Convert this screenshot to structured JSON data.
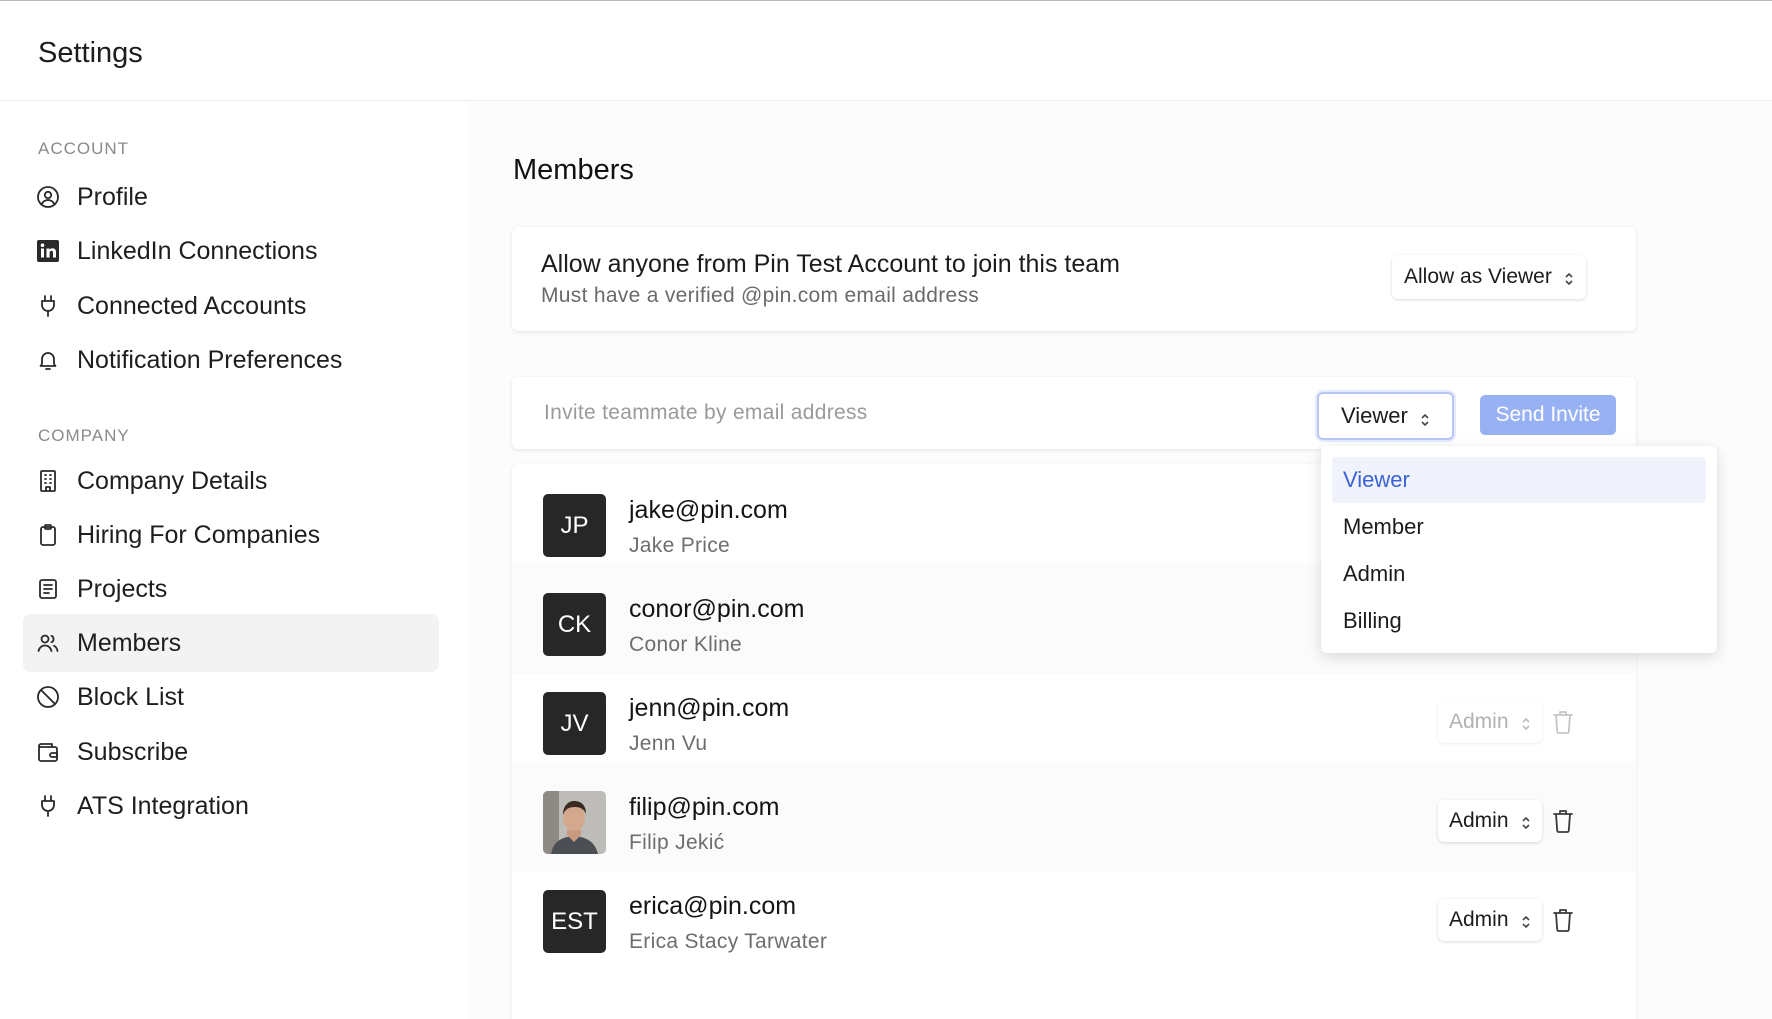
{
  "app": {
    "title": "Settings"
  },
  "sidebar": {
    "sections": [
      {
        "label": "ACCOUNT",
        "items": [
          {
            "label": "Profile",
            "icon": "user-circle-icon"
          },
          {
            "label": "LinkedIn Connections",
            "icon": "linkedin-icon"
          },
          {
            "label": "Connected Accounts",
            "icon": "plug-icon"
          },
          {
            "label": "Notification Preferences",
            "icon": "bell-icon"
          }
        ]
      },
      {
        "label": "COMPANY",
        "items": [
          {
            "label": "Company Details",
            "icon": "building-icon"
          },
          {
            "label": "Hiring For Companies",
            "icon": "clipboard-icon"
          },
          {
            "label": "Projects",
            "icon": "document-icon"
          },
          {
            "label": "Members",
            "icon": "users-icon",
            "active": true
          },
          {
            "label": "Block List",
            "icon": "block-icon"
          },
          {
            "label": "Subscribe",
            "icon": "wallet-icon"
          },
          {
            "label": "ATS Integration",
            "icon": "plug-icon"
          }
        ]
      }
    ]
  },
  "main": {
    "title": "Members",
    "allow": {
      "title": "Allow anyone from Pin Test Account to join this team",
      "subtitle": "Must have a verified @pin.com email address",
      "select_value": "Allow as Viewer"
    },
    "invite": {
      "placeholder": "Invite teammate by email address",
      "value": "",
      "role_value": "Viewer",
      "send_label": "Send Invite"
    },
    "role_dropdown": {
      "options": [
        "Viewer",
        "Member",
        "Admin",
        "Billing"
      ],
      "selected": "Viewer"
    },
    "members": [
      {
        "email": "jake@pin.com",
        "name": "Jake Price",
        "initials": "JP",
        "role": "",
        "photo": false,
        "disabled": false
      },
      {
        "email": "conor@pin.com",
        "name": "Conor Kline",
        "initials": "CK",
        "role": "",
        "photo": false,
        "disabled": false
      },
      {
        "email": "jenn@pin.com",
        "name": "Jenn Vu",
        "initials": "JV",
        "role": "Admin",
        "photo": false,
        "disabled": true
      },
      {
        "email": "filip@pin.com",
        "name": "Filip Jekić",
        "initials": "",
        "role": "Admin",
        "photo": true,
        "disabled": false
      },
      {
        "email": "erica@pin.com",
        "name": "Erica Stacy Tarwater",
        "initials": "EST",
        "role": "Admin",
        "photo": false,
        "disabled": false
      }
    ]
  },
  "colors": {
    "accent": "#3b63d6",
    "send_button": "#98b1f3",
    "avatar_bg": "#272727"
  }
}
